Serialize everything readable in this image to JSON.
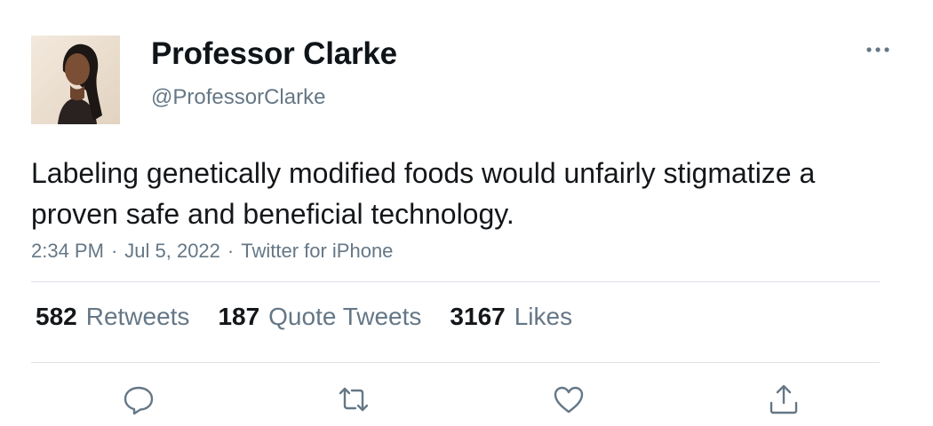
{
  "author": {
    "display_name": "Professor Clarke",
    "handle": "@ProfessorClarke"
  },
  "tweet": {
    "text": "Labeling genetically modified foods would unfairly stigmatize a proven safe and beneficial technology.",
    "time": "2:34 PM",
    "date": "Jul 5, 2022",
    "source": "Twitter for iPhone",
    "separator": "·"
  },
  "stats": {
    "retweets": {
      "count": "582",
      "label": "Retweets"
    },
    "quote_tweets": {
      "count": "187",
      "label": "Quote Tweets"
    },
    "likes": {
      "count": "3167",
      "label": "Likes"
    }
  },
  "icons": {
    "more": "more-horizontal-icon",
    "reply": "reply-bubble-icon",
    "retweet": "retweet-icon",
    "like": "heart-icon",
    "share": "share-icon"
  },
  "colors": {
    "text": "#14171a",
    "secondary": "#657786",
    "divider": "#dde3e8",
    "background": "#ffffff"
  }
}
